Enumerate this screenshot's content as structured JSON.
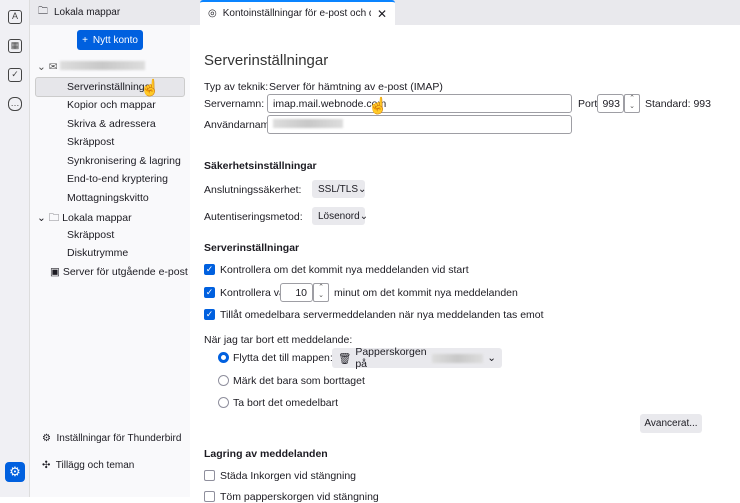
{
  "tabs": [
    {
      "label": "Lokala mappar",
      "icon": "folder-icon"
    },
    {
      "label": "Kontoinställningar för e-post och di",
      "icon": "account-settings-icon"
    }
  ],
  "sidebar": {
    "new_account": "Nytt konto",
    "items": [
      "Serverinställningar",
      "Kopior och mappar",
      "Skriva & adressera",
      "Skräppost",
      "Synkronisering & lagring",
      "End-to-end kryptering",
      "Mottagningskvitto"
    ],
    "local_folders": "Lokala mappar",
    "local_items": [
      "Skräppost",
      "Diskutrymme"
    ],
    "outgoing": "Server för utgående e-post",
    "settings": "Inställningar för Thunderbird",
    "addons": "Tillägg och teman"
  },
  "main": {
    "title": "Serverinställningar",
    "type_label": "Typ av teknik:",
    "type_value": "Server för hämtning av e-post (IMAP)",
    "server_label": "Servernamn:",
    "server_value": "imap.mail.webnode.com",
    "port_label": "Port:",
    "port_value": "993",
    "standard": "Standard: 993",
    "user_label": "Användarnamn:",
    "security_heading": "Säkerhetsinställningar",
    "conn_label": "Anslutningssäkerhet:",
    "conn_value": "SSL/TLS",
    "auth_label": "Autentiseringsmetod:",
    "auth_value": "Lösenord",
    "server_heading": "Serverinställningar",
    "check_start": "Kontrollera om det kommit nya meddelanden vid start",
    "check_every": "Kontrollera var",
    "minutes": "10",
    "check_every_suffix": "minut om det kommit nya meddelanden",
    "allow_push": "Tillåt omedelbara servermeddelanden när nya meddelanden tas emot",
    "delete_label": "När jag tar bort ett meddelande:",
    "move_to": "Flytta det till mappen:",
    "trash_folder": "Papperskorgen på",
    "mark_deleted": "Märk det bara som borttaget",
    "delete_now": "Ta bort det omedelbart",
    "advanced": "Avancerat...",
    "storage_heading": "Lagring av meddelanden",
    "clean_inbox": "Städa Inkorgen vid stängning",
    "empty_trash": "Töm papperskorgen vid stängning"
  }
}
